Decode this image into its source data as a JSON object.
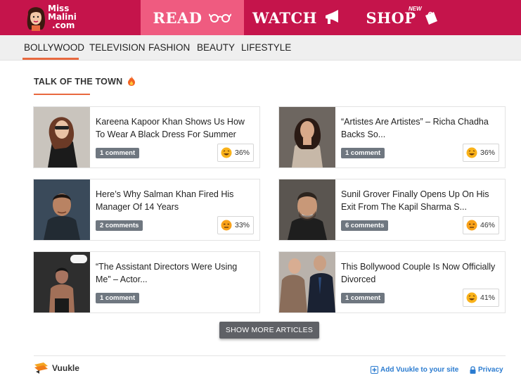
{
  "brand": {
    "line1": "Miss",
    "line2": "Malini",
    "line3": ".com"
  },
  "nav": {
    "read": "READ",
    "watch": "WATCH",
    "shop": "SHOP",
    "shop_badge": "NEW"
  },
  "subnav": {
    "items": [
      "BOLLYWOOD",
      "TELEVISION",
      "FASHION",
      "BEAUTY",
      "LIFESTYLE"
    ],
    "active": "BOLLYWOOD"
  },
  "section": {
    "title": "TALK OF THE TOWN"
  },
  "articles": [
    {
      "title": "Kareena Kapoor Khan Shows Us How To Wear A Black Dress For Summer",
      "comments": "1 comment",
      "reaction": "36%"
    },
    {
      "title": "“Artistes Are Artistes” – Richa Chadha Backs So...",
      "comments": "1 comment",
      "reaction": "36%"
    },
    {
      "title": "Here’s Why Salman Khan Fired His Manager Of 14 Years",
      "comments": "2 comments",
      "reaction": "33%"
    },
    {
      "title": "Sunil Grover Finally Opens Up On His Exit From The Kapil Sharma S...",
      "comments": "6 comments",
      "reaction": "46%"
    },
    {
      "title": "“The Assistant Directors Were Using Me” – Actor...",
      "comments": "1 comment",
      "reaction": ""
    },
    {
      "title": "This Bollywood Couple Is Now Officially Divorced",
      "comments": "1 comment",
      "reaction": "41%"
    }
  ],
  "show_more": "SHOW MORE ARTICLES",
  "footer": {
    "vuukle": "Vuukle",
    "add_vuukle": "Add Vuukle to your site",
    "privacy": "Privacy"
  },
  "colors": {
    "header": "#c5144b",
    "read_tab": "#ef5b80",
    "accent": "#e8693f",
    "link": "#2a7bd0"
  }
}
